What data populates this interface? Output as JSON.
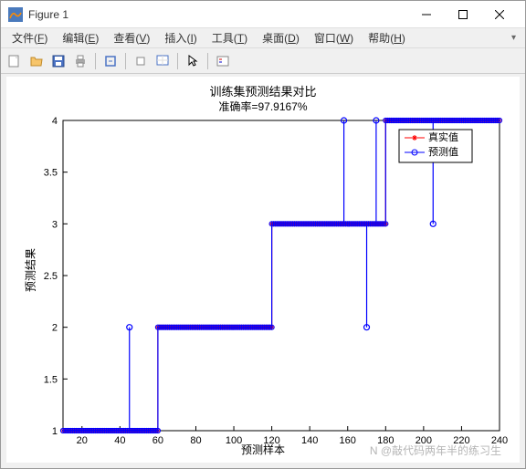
{
  "window": {
    "title": "Figure 1"
  },
  "menubar": {
    "items": [
      {
        "label": "文件",
        "u": "F"
      },
      {
        "label": "编辑",
        "u": "E"
      },
      {
        "label": "查看",
        "u": "V"
      },
      {
        "label": "插入",
        "u": "I"
      },
      {
        "label": "工具",
        "u": "T"
      },
      {
        "label": "桌面",
        "u": "D"
      },
      {
        "label": "窗口",
        "u": "W"
      },
      {
        "label": "帮助",
        "u": "H"
      }
    ]
  },
  "toolbar": {
    "icons": [
      "new",
      "open",
      "save",
      "print",
      "sep",
      "link",
      "sep",
      "rotate",
      "datacursor",
      "sep",
      "cursor",
      "sep",
      "insert-legend"
    ]
  },
  "chart_data": {
    "type": "line",
    "title": "训练集预测结果对比",
    "subtitle": "准确率=97.9167%",
    "xlabel": "预测样本",
    "ylabel": "预测结果",
    "xlim": [
      10,
      240
    ],
    "ylim": [
      1,
      4
    ],
    "xticks": [
      20,
      40,
      60,
      80,
      100,
      120,
      140,
      160,
      180,
      200,
      220,
      240
    ],
    "yticks": [
      1,
      1.5,
      2,
      2.5,
      3,
      3.5,
      4
    ],
    "legend": {
      "position": "top-right",
      "entries": [
        {
          "name": "真实值",
          "color": "#ff0000",
          "marker": "*"
        },
        {
          "name": "预测值",
          "color": "#0000ff",
          "marker": "o"
        }
      ]
    },
    "series": [
      {
        "name": "真实值",
        "color": "#ff0000",
        "marker": "*",
        "segments": [
          {
            "x0": 10,
            "x1": 60,
            "y": 1
          },
          {
            "x0": 60,
            "x1": 120,
            "y": 2
          },
          {
            "x0": 120,
            "x1": 180,
            "y": 3
          },
          {
            "x0": 180,
            "x1": 240,
            "y": 4
          }
        ]
      },
      {
        "name": "预测值",
        "color": "#0000ff",
        "marker": "o",
        "segments": [
          {
            "x0": 10,
            "x1": 60,
            "y": 1
          },
          {
            "x0": 60,
            "x1": 120,
            "y": 2
          },
          {
            "x0": 120,
            "x1": 180,
            "y": 3
          },
          {
            "x0": 180,
            "x1": 240,
            "y": 4
          }
        ],
        "outliers": [
          {
            "x": 45,
            "y": 2
          },
          {
            "x": 158,
            "y": 4
          },
          {
            "x": 170,
            "y": 2
          },
          {
            "x": 175,
            "y": 4
          },
          {
            "x": 205,
            "y": 3
          }
        ]
      }
    ]
  },
  "watermark": "N @敲代码两年半的练习生"
}
